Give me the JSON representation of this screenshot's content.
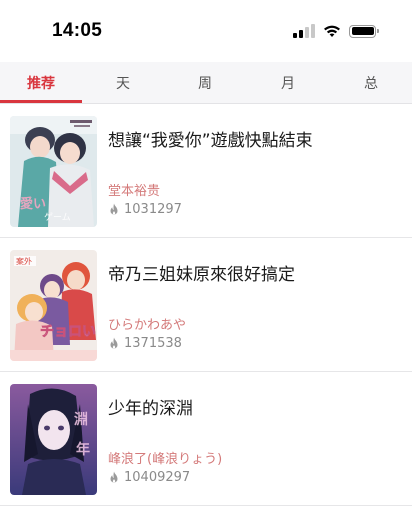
{
  "status_bar": {
    "time": "14:05",
    "icons": [
      "signal-icon",
      "wifi-icon",
      "battery-icon"
    ]
  },
  "tabs": [
    {
      "label": "推荐",
      "active": true
    },
    {
      "label": "天",
      "active": false
    },
    {
      "label": "周",
      "active": false
    },
    {
      "label": "月",
      "active": false
    },
    {
      "label": "总",
      "active": false
    }
  ],
  "colors": {
    "accent": "#d9363e",
    "author": "#d47a7a",
    "meta": "#8a8a8a"
  },
  "list": [
    {
      "title": "想讓“我愛你”遊戲快點結束",
      "author": "堂本裕贵",
      "hot": "1031297",
      "icon": "flame-icon"
    },
    {
      "title": "帝乃三姐妹原來很好搞定",
      "author": "ひらかわあや",
      "hot": "1371538",
      "icon": "flame-icon"
    },
    {
      "title": "少年的深淵",
      "author": "峰浪了(峰浪りょう)",
      "hot": "10409297",
      "icon": "flame-icon"
    }
  ]
}
